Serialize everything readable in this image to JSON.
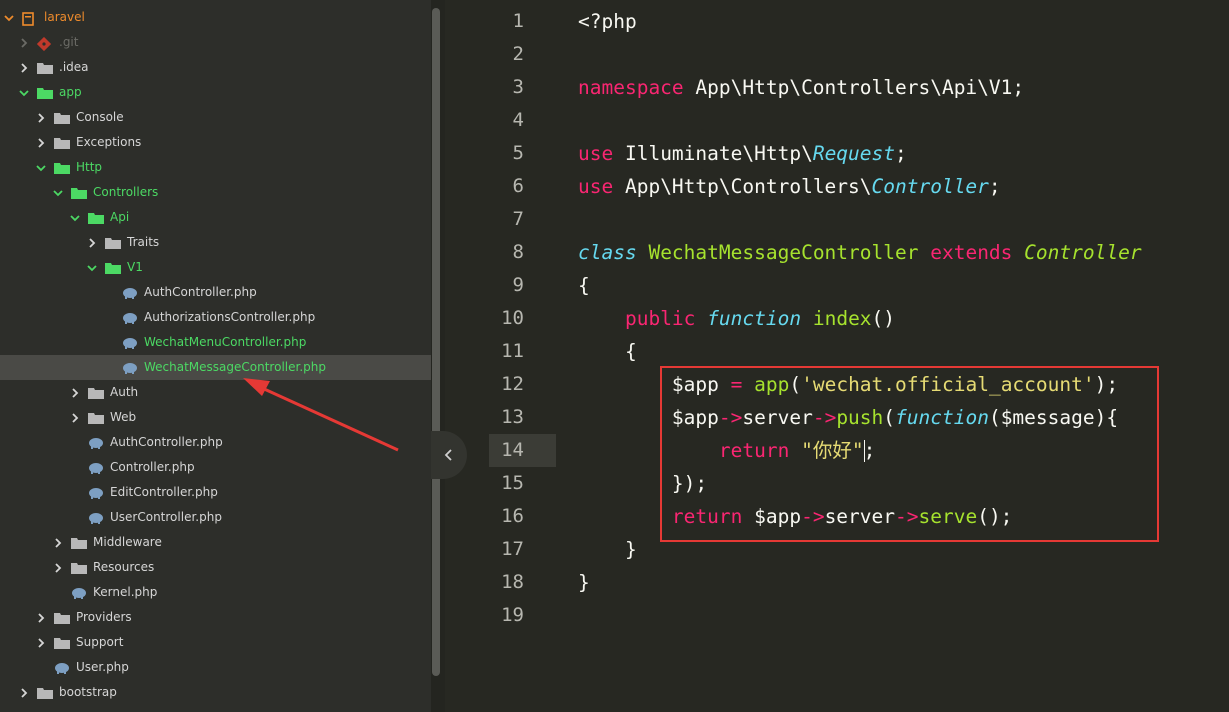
{
  "sidebar": {
    "items": [
      {
        "label": "laravel",
        "state": "root"
      },
      {
        "label": ".git",
        "state": "git"
      },
      {
        "label": ".idea",
        "state": "closed"
      },
      {
        "label": "app",
        "state": "open"
      },
      {
        "label": "Console",
        "state": "closed"
      },
      {
        "label": "Exceptions",
        "state": "closed"
      },
      {
        "label": "Http",
        "state": "open"
      },
      {
        "label": "Controllers",
        "state": "open"
      },
      {
        "label": "Api",
        "state": "open"
      },
      {
        "label": "Traits",
        "state": "closed"
      },
      {
        "label": "V1",
        "state": "open"
      },
      {
        "label": "AuthController.php",
        "state": "file"
      },
      {
        "label": "AuthorizationsController.php",
        "state": "file"
      },
      {
        "label": "WechatMenuController.php",
        "state": "file-green"
      },
      {
        "label": "WechatMessageController.php",
        "state": "file-green-selected"
      },
      {
        "label": "Auth",
        "state": "closed"
      },
      {
        "label": "Web",
        "state": "closed"
      },
      {
        "label": "AuthController.php",
        "state": "file"
      },
      {
        "label": "Controller.php",
        "state": "file"
      },
      {
        "label": "EditController.php",
        "state": "file"
      },
      {
        "label": "UserController.php",
        "state": "file"
      },
      {
        "label": "Middleware",
        "state": "closed"
      },
      {
        "label": "Resources",
        "state": "closed"
      },
      {
        "label": "Kernel.php",
        "state": "file"
      },
      {
        "label": "Providers",
        "state": "closed"
      },
      {
        "label": "Support",
        "state": "closed"
      },
      {
        "label": "User.php",
        "state": "file"
      },
      {
        "label": "bootstrap",
        "state": "closed"
      }
    ]
  },
  "editor": {
    "line_numbers": [
      "1",
      "2",
      "3",
      "4",
      "5",
      "6",
      "7",
      "8",
      "9",
      "10",
      "11",
      "12",
      "13",
      "14",
      "15",
      "16",
      "17",
      "18",
      "19"
    ],
    "current_line": "14",
    "code": {
      "l1": "<?php",
      "l3_kw": "namespace",
      "l3_rest": " App\\Http\\Controllers\\Api\\V1;",
      "l5_kw": "use",
      "l5_ns": " Illuminate\\Http\\",
      "l5_cls": "Request",
      "l5_end": ";",
      "l6_kw": "use",
      "l6_ns": " App\\Http\\Controllers\\",
      "l6_cls": "Controller",
      "l6_end": ";",
      "l8_kw": "class",
      "l8_name": "WechatMessageController",
      "l8_ext": "extends",
      "l8_parent": "Controller",
      "l9": "{",
      "l10_kw": "public",
      "l10_fn": "function",
      "l10_name": "index",
      "l10_end": "()",
      "l11": "{",
      "l12_var": "$app",
      "l12_op": " = ",
      "l12_fn": "app",
      "l12_p1": "(",
      "l12_str": "'wechat.official_account'",
      "l12_p2": ");",
      "l13_var": "$app",
      "l13_op1": "->",
      "l13_prop": "server",
      "l13_op2": "->",
      "l13_fn": "push",
      "l13_p1": "(",
      "l13_kwfn": "function",
      "l13_p2": "($message){",
      "l14_kw": "return",
      "l14_str": "\"你好\"",
      "l14_end": ";",
      "l15": "});",
      "l16_kw": "return",
      "l16_var": " $app",
      "l16_op1": "->",
      "l16_prop": "server",
      "l16_op2": "->",
      "l16_fn": "serve",
      "l16_end": "();",
      "l17": "}",
      "l18": "}"
    }
  },
  "colors": {
    "keyword": "#f92672",
    "storage_italic": "#66d9ef",
    "class_name": "#a6e22e",
    "string": "#e6db74",
    "tree_open": "#4cd964",
    "annotation_red": "#e53935"
  }
}
